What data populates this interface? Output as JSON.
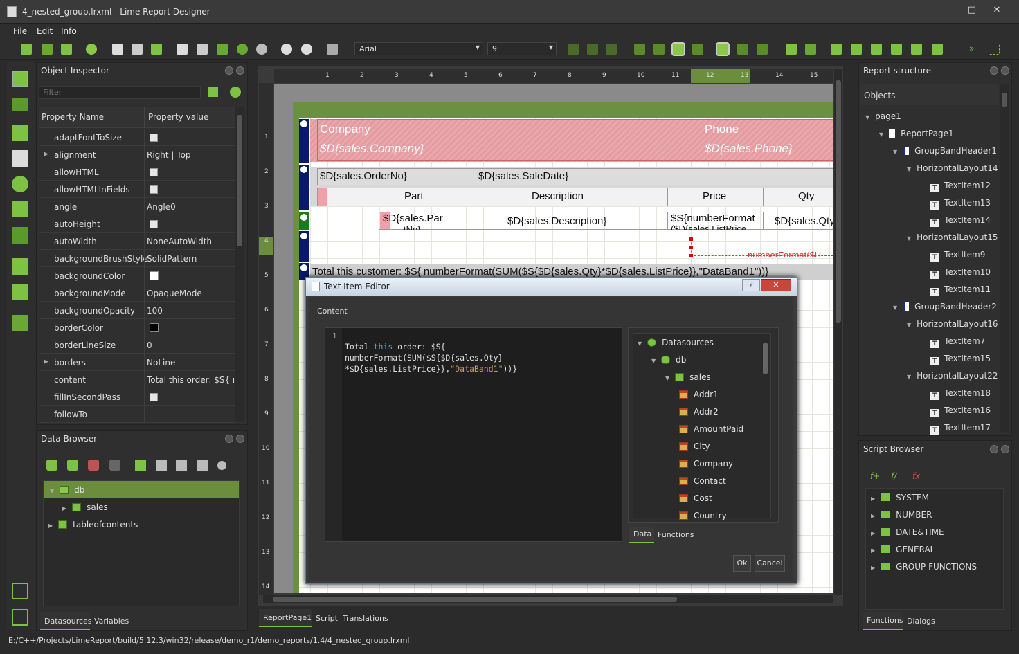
{
  "window": {
    "title": "4_nested_group.lrxml - Lime Report Designer",
    "min": "—",
    "max": "□",
    "close": "✕"
  },
  "menu": [
    "File",
    "Edit",
    "Info"
  ],
  "toolbar": {
    "font": "Arial",
    "size": "9"
  },
  "object_inspector": {
    "title": "Object Inspector",
    "filter_placeholder": "Filter",
    "col_name": "Property Name",
    "col_value": "Property value",
    "rows": [
      {
        "name": "adaptFontToSize",
        "value": "",
        "type": "check"
      },
      {
        "name": "alignment",
        "value": "Right | Top",
        "type": "text",
        "expand": true
      },
      {
        "name": "allowHTML",
        "value": "",
        "type": "check"
      },
      {
        "name": "allowHTMLInFields",
        "value": "",
        "type": "check"
      },
      {
        "name": "angle",
        "value": "Angle0",
        "type": "text"
      },
      {
        "name": "autoHeight",
        "value": "",
        "type": "check"
      },
      {
        "name": "autoWidth",
        "value": "NoneAutoWidth",
        "type": "text"
      },
      {
        "name": "backgroundBrushStyle",
        "value": "SolidPattern",
        "type": "text"
      },
      {
        "name": "backgroundColor",
        "value": "",
        "type": "white"
      },
      {
        "name": "backgroundMode",
        "value": "OpaqueMode",
        "type": "text"
      },
      {
        "name": "backgroundOpacity",
        "value": "100",
        "type": "text"
      },
      {
        "name": "borderColor",
        "value": "",
        "type": "black"
      },
      {
        "name": "borderLineSize",
        "value": "0",
        "type": "text"
      },
      {
        "name": "borders",
        "value": "NoLine",
        "type": "text",
        "expand": true
      },
      {
        "name": "content",
        "value": "Total this order: $S{ n...",
        "type": "text"
      },
      {
        "name": "fillInSecondPass",
        "value": "",
        "type": "check"
      },
      {
        "name": "followTo",
        "value": "",
        "type": "text"
      }
    ]
  },
  "data_browser": {
    "title": "Data Browser",
    "items": [
      {
        "label": "db"
      },
      {
        "label": "sales"
      },
      {
        "label": "tableofcontents"
      }
    ],
    "tabs": [
      "Datasources",
      "Variables"
    ]
  },
  "ruler": {
    "top": [
      "1",
      "2",
      "3",
      "4",
      "5",
      "6",
      "7",
      "8",
      "9",
      "10",
      "11",
      "12",
      "13",
      "14",
      "15"
    ],
    "left": [
      "1",
      "2",
      "3",
      "4",
      "5",
      "6",
      "7",
      "8",
      "9",
      "10",
      "11",
      "12",
      "13",
      "14"
    ]
  },
  "report": {
    "company_label": "Company",
    "phone_label": "Phone",
    "company_field": "$D{sales.Company}",
    "phone_field": "$D{sales.Phone}",
    "order_no": "$D{sales.OrderNo}",
    "sale_date": "$D{sales.SaleDate}",
    "col_part": "Part",
    "col_desc": "Description",
    "col_price": "Price",
    "col_qty": "Qty",
    "part_field": "$D{sales.Par",
    "part_field2": "tNo}",
    "desc_field": "$D{sales.Description}",
    "price_field": "$S{numberFormat",
    "price_field2": "($D{sales.ListPrice",
    "qty_field": "$D{sales.Qty",
    "numformat_partial": "numberFormat($U",
    "total_customer": "Total this customer: $S{ numberFormat(SUM($S{$D{sales.Qty}*$D{sales.ListPrice}},\"DataBand1\"))}"
  },
  "bottom_tabs": [
    "ReportPage1",
    "Script",
    "Translations"
  ],
  "report_structure": {
    "title": "Report structure",
    "header": "Objects",
    "items": [
      {
        "label": "page1",
        "level": 0,
        "icon": "none",
        "tri": true
      },
      {
        "label": "ReportPage1",
        "level": 1,
        "icon": "page",
        "tri": true
      },
      {
        "label": "GroupBandHeader1",
        "level": 2,
        "icon": "group",
        "tri": true
      },
      {
        "label": "HorizontalLayout14",
        "level": 3,
        "icon": "none",
        "tri": true
      },
      {
        "label": "TextItem12",
        "level": 4,
        "icon": "text"
      },
      {
        "label": "TextItem13",
        "level": 4,
        "icon": "text"
      },
      {
        "label": "TextItem14",
        "level": 4,
        "icon": "text"
      },
      {
        "label": "HorizontalLayout15",
        "level": 3,
        "icon": "none",
        "tri": true
      },
      {
        "label": "TextItem9",
        "level": 4,
        "icon": "text"
      },
      {
        "label": "TextItem10",
        "level": 4,
        "icon": "text"
      },
      {
        "label": "TextItem11",
        "level": 4,
        "icon": "text"
      },
      {
        "label": "GroupBandHeader2",
        "level": 2,
        "icon": "group",
        "tri": true
      },
      {
        "label": "HorizontalLayout16",
        "level": 3,
        "icon": "none",
        "tri": true
      },
      {
        "label": "TextItem7",
        "level": 4,
        "icon": "text"
      },
      {
        "label": "TextItem15",
        "level": 4,
        "icon": "text"
      },
      {
        "label": "HorizontalLayout22",
        "level": 3,
        "icon": "none",
        "tri": true
      },
      {
        "label": "TextItem18",
        "level": 4,
        "icon": "text"
      },
      {
        "label": "TextItem16",
        "level": 4,
        "icon": "text"
      },
      {
        "label": "TextItem17",
        "level": 4,
        "icon": "text"
      }
    ]
  },
  "script_browser": {
    "title": "Script Browser",
    "items": [
      "SYSTEM",
      "NUMBER",
      "DATE&TIME",
      "GENERAL",
      "GROUP FUNCTIONS"
    ],
    "tabs": [
      "Functions",
      "Dialogs"
    ]
  },
  "dialog": {
    "title": "Text Item Editor",
    "help": "?",
    "close": "✕",
    "content_label": "Content",
    "line_no": "1",
    "code": {
      "l1a": "Total ",
      "l1b": "this",
      "l1c": " order: $S{",
      "l2": "numberFormat(SUM($S{$D{sales.Qty}",
      "l3a": "*$D{sales.ListPrice}},",
      "l3b": "\"DataBand1\"",
      "l3c": "))}"
    },
    "tree": [
      {
        "label": "Datasources",
        "level": 0,
        "icon": "ds"
      },
      {
        "label": "db",
        "level": 1,
        "icon": "db"
      },
      {
        "label": "sales",
        "level": 2,
        "icon": "table"
      },
      {
        "label": "Addr1",
        "level": 3,
        "icon": "field"
      },
      {
        "label": "Addr2",
        "level": 3,
        "icon": "field"
      },
      {
        "label": "AmountPaid",
        "level": 3,
        "icon": "field"
      },
      {
        "label": "City",
        "level": 3,
        "icon": "field"
      },
      {
        "label": "Company",
        "level": 3,
        "icon": "field"
      },
      {
        "label": "Contact",
        "level": 3,
        "icon": "field"
      },
      {
        "label": "Cost",
        "level": 3,
        "icon": "field"
      },
      {
        "label": "Country",
        "level": 3,
        "icon": "field"
      }
    ],
    "tabs": [
      "Data",
      "Functions"
    ],
    "ok": "Ok",
    "cancel": "Cancel"
  },
  "status": "E:/C++/Projects/LimeReport/build/5.12.3/win32/release/demo_r1/demo_reports/1.4/4_nested_group.lrxml"
}
